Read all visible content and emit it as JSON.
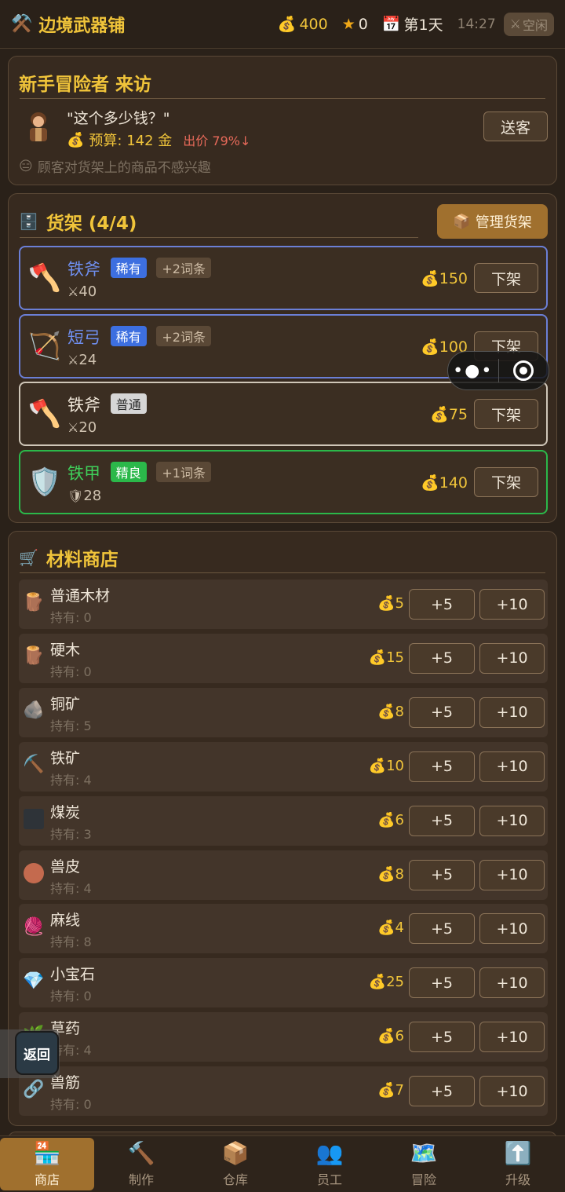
{
  "header": {
    "title": "边境武器铺",
    "gold": "400",
    "reputation": "0",
    "day": "第1天",
    "clock": "14:27",
    "idle_label": "空闲"
  },
  "visitor": {
    "title": "新手冒险者 来访",
    "quote": "\"这个多少钱？\"",
    "budget": "预算: 142 金",
    "offer": "出价 79%↓",
    "dismiss_label": "送客",
    "hint": "顾客对货架上的商品不感兴趣"
  },
  "shelf": {
    "title": "货架 (4/4)",
    "manage_label": "管理货架",
    "remove_label": "下架",
    "items": [
      {
        "name": "铁斧",
        "rarity": "稀有",
        "affix": "+2词条",
        "stat": "40",
        "price": "150",
        "icon": "axe-icon",
        "color": "#6f8ff0",
        "border": "#6b7fd6"
      },
      {
        "name": "短弓",
        "rarity": "稀有",
        "affix": "+2词条",
        "stat": "24",
        "price": "100",
        "icon": "bow-icon",
        "color": "#6f8ff0",
        "border": "#6b7fd6"
      },
      {
        "name": "铁斧",
        "rarity": "普通",
        "affix": "",
        "stat": "20",
        "price": "75",
        "icon": "axe-icon",
        "color": "#efe6d8",
        "border": "#cfc6b8"
      },
      {
        "name": "铁甲",
        "rarity": "精良",
        "affix": "+1词条",
        "stat": "28",
        "price": "140",
        "icon": "shield-icon",
        "color": "#3fcf5a",
        "border": "#2bb84a"
      }
    ]
  },
  "materials": {
    "title": "材料商店",
    "btn5": "+5",
    "btn10": "+10",
    "items": [
      {
        "name": "普通木材",
        "owned": "持有: 0",
        "price": "5",
        "icon": "wood-log-icon"
      },
      {
        "name": "硬木",
        "owned": "持有: 0",
        "price": "15",
        "icon": "wood-log-icon"
      },
      {
        "name": "铜矿",
        "owned": "持有: 5",
        "price": "8",
        "icon": "ore-icon"
      },
      {
        "name": "铁矿",
        "owned": "持有: 4",
        "price": "10",
        "icon": "pickaxe-icon"
      },
      {
        "name": "煤炭",
        "owned": "持有: 3",
        "price": "6",
        "icon": "coal-icon"
      },
      {
        "name": "兽皮",
        "owned": "持有: 4",
        "price": "8",
        "icon": "hide-icon"
      },
      {
        "name": "麻线",
        "owned": "持有: 8",
        "price": "4",
        "icon": "yarn-icon"
      },
      {
        "name": "小宝石",
        "owned": "持有: 0",
        "price": "25",
        "icon": "gem-icon"
      },
      {
        "name": "草药",
        "owned": "持有: 4",
        "price": "6",
        "icon": "herb-icon"
      },
      {
        "name": "兽筋",
        "owned": "持有: 0",
        "price": "7",
        "icon": "chain-icon"
      }
    ]
  },
  "float_back": "返回",
  "tabs": [
    {
      "label": "商店",
      "icon": "shop-icon",
      "active": true
    },
    {
      "label": "制作",
      "icon": "hammer-icon",
      "active": false
    },
    {
      "label": "仓库",
      "icon": "box-icon",
      "active": false
    },
    {
      "label": "员工",
      "icon": "staff-icon",
      "active": false
    },
    {
      "label": "冒险",
      "icon": "map-icon",
      "active": false
    },
    {
      "label": "升级",
      "icon": "upgrade-icon",
      "active": false
    }
  ]
}
